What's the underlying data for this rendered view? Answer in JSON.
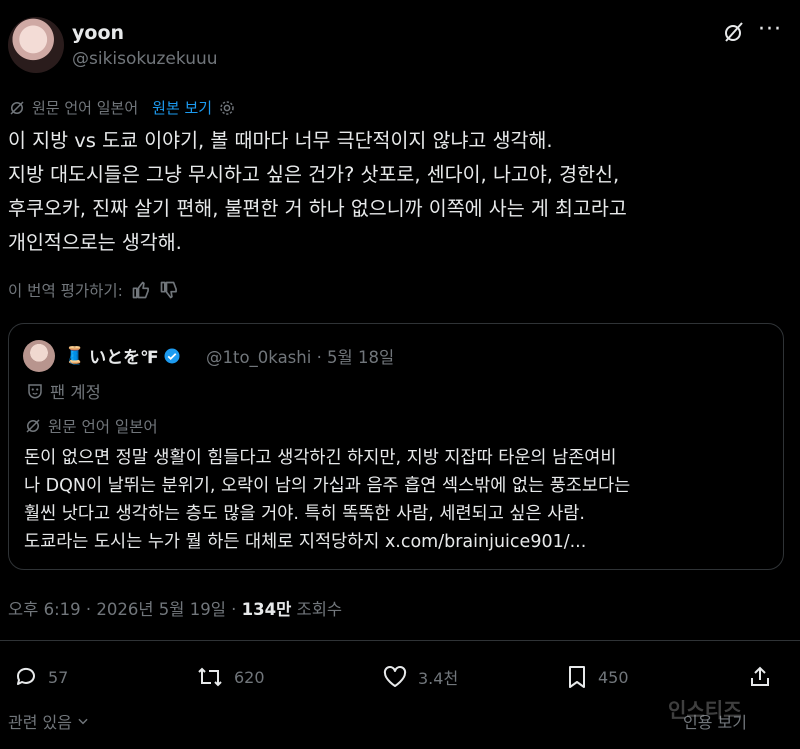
{
  "author": {
    "name": "yoon",
    "handle": "@sikisokuzekuuu"
  },
  "header_icons": {
    "grok": "grok-icon",
    "more": "···"
  },
  "translation": {
    "label": "원문 언어 일본어",
    "show_original": "원본 보기"
  },
  "tweet_lines": [
    "이 지방 vs 도쿄 이야기, 볼 때마다 너무 극단적이지 않냐고 생각해.",
    "지방 대도시들은 그냥 무시하고 싶은 건가? 삿포로, 센다이, 나고야, 경한신,",
    "후쿠오카, 진짜 살기 편해, 불편한 거 하나 없으니까 이쪽에 사는 게 최고라고",
    "개인적으로는 생각해."
  ],
  "rate_translation": "이 번역 평가하기:",
  "quote": {
    "name": "いとを℉",
    "name_emoji": "🧵",
    "handle_date": "@1to_0kashi · 5월 18일",
    "badge": "팬 계정",
    "translation_label": "원문 언어 일본어",
    "lines": [
      "돈이 없으면 정말 생활이 힘들다고 생각하긴 하지만, 지방 지잡따 타운의 남존여비",
      "나 DQN이 날뛰는 분위기, 오락이 남의 가십과 음주 흡연 섹스밖에 없는 풍조보다는",
      "훨씬 낫다고 생각하는 층도 많을 거야. 특히 똑똑한 사람, 세련되고 싶은 사람.",
      "도쿄라는 도시는 누가 뭘 하든 대체로 지적당하지 x.com/brainjuice901/..."
    ]
  },
  "timestamp": {
    "prefix": "오후 6:19 · 2026년 5월 19일 · ",
    "views": "134만",
    "views_label": " 조회수"
  },
  "actions": {
    "replies": "57",
    "reposts": "620",
    "likes": "3.4천",
    "bookmarks": "450"
  },
  "footer": {
    "related": "관련 있음",
    "translate_more": "인용 보기"
  },
  "watermark": "인스티즈",
  "colors": {
    "background": "#000000",
    "text": "#e7e9ea",
    "muted": "#71767b",
    "link": "#1d9bf0",
    "verified": "#1d9bf0"
  }
}
